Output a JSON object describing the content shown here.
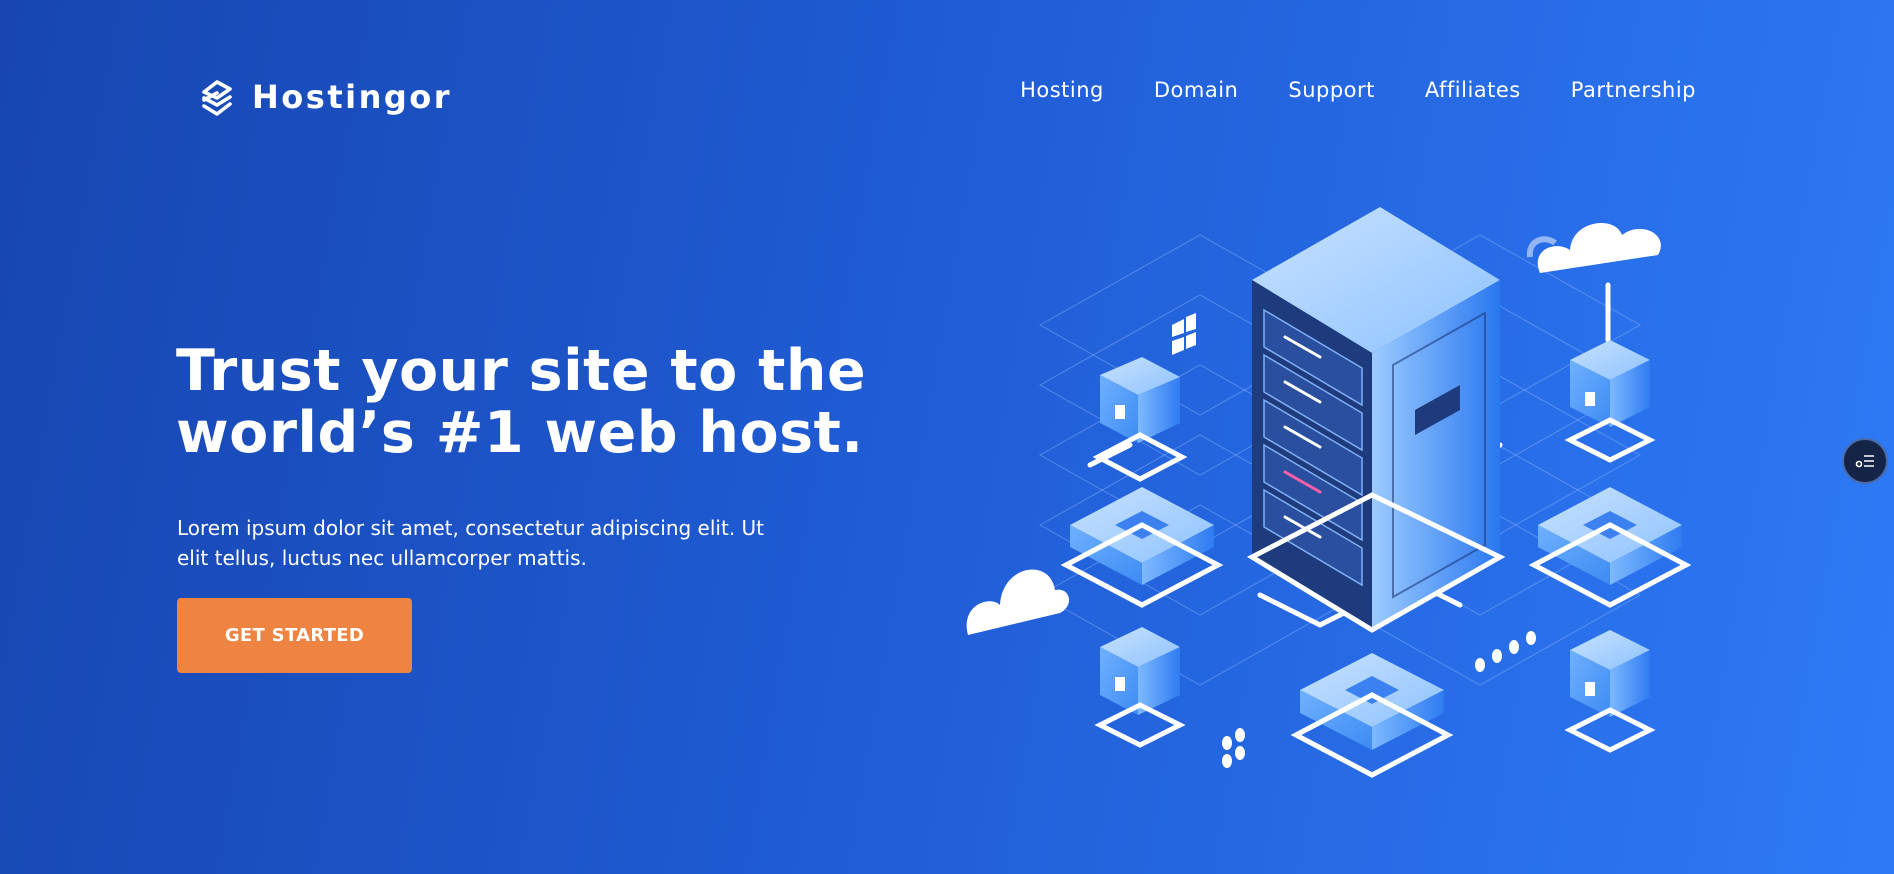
{
  "brand": {
    "name": "Hostingor"
  },
  "nav": {
    "items": [
      {
        "label": "Hosting"
      },
      {
        "label": "Domain"
      },
      {
        "label": "Support"
      },
      {
        "label": "Affiliates"
      },
      {
        "label": "Partnership"
      }
    ]
  },
  "hero": {
    "title_lines": [
      "Trust your site to the",
      "world’s #1 web host."
    ],
    "text_lines": [
      "Lorem ipsum dolor sit amet, consectetur adipiscing elit. Ut",
      "elit tellus, luctus nec ullamcorper mattis."
    ],
    "cta_label": "GET STARTED"
  },
  "icons": {
    "logo": "hostingor-logo-icon",
    "illustration": "server-network-illustration",
    "side_toggle": "settings-menu-icon"
  },
  "colors": {
    "bg_start": "#1746b0",
    "bg_end": "#2e7af6",
    "cta": "#ef8442",
    "side_toggle": "#142447"
  }
}
